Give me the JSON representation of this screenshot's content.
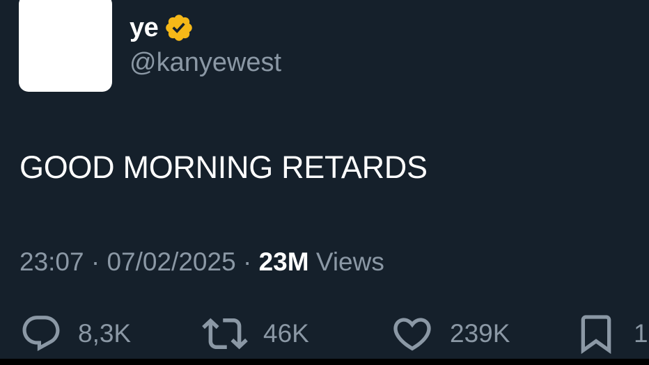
{
  "author": {
    "display_name": "ye",
    "handle": "@kanyewest",
    "verified_icon": "verified-badge-gold"
  },
  "tweet": {
    "text": "GOOD MORNING RETARDS"
  },
  "meta": {
    "time": "23:07",
    "separator": "·",
    "date": "07/02/2025",
    "views_count": "23M",
    "views_label": "Views"
  },
  "actions": {
    "reply": {
      "icon": "reply-icon",
      "count": "8,3K"
    },
    "retweet": {
      "icon": "retweet-icon",
      "count": "46K"
    },
    "like": {
      "icon": "heart-icon",
      "count": "239K"
    },
    "bookmark": {
      "icon": "bookmark-icon",
      "count": "1"
    }
  },
  "colors": {
    "background": "#15202b",
    "muted": "#8b98a5",
    "badge": "#f5b818"
  }
}
